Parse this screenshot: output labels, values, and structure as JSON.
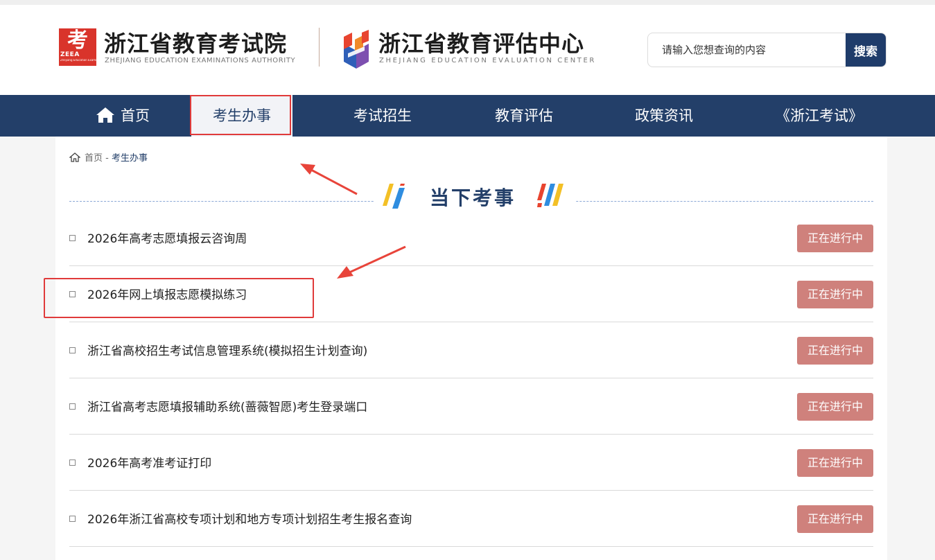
{
  "header": {
    "logo1": {
      "mark_glyph": "考",
      "mark_abbr": "ZEEA",
      "mark_tiny": "Zhejiang Education Examinations Authority",
      "title": "浙江省教育考试院",
      "subtitle": "ZHEJIANG EDUCATION EXAMINATIONS AUTHORITY"
    },
    "logo2": {
      "title": "浙江省教育评估中心",
      "subtitle": "ZHEJIANG EDUCATION EVALUATION CENTER"
    },
    "search": {
      "placeholder": "请输入您想查询的内容",
      "button_label": "搜索"
    }
  },
  "nav": {
    "items": [
      {
        "label": "首页",
        "icon": "home-icon"
      },
      {
        "label": "考生办事",
        "active": true
      },
      {
        "label": "考试招生"
      },
      {
        "label": "教育评估"
      },
      {
        "label": "政策资讯"
      },
      {
        "label": "《浙江考试》"
      }
    ]
  },
  "breadcrumb": {
    "home": "首页",
    "separator": "-",
    "current": "考生办事"
  },
  "section": {
    "title": "当下考事"
  },
  "items": [
    {
      "title": "2026年高考志愿填报云咨询周",
      "status": "正在进行中"
    },
    {
      "title": "2026年网上填报志愿模拟练习",
      "status": "正在进行中"
    },
    {
      "title": "浙江省高校招生考试信息管理系统(模拟招生计划查询)",
      "status": "正在进行中"
    },
    {
      "title": "浙江省高考志愿填报辅助系统(蔷薇智愿)考生登录端口",
      "status": "正在进行中"
    },
    {
      "title": "2026年高考准考证打印",
      "status": "正在进行中"
    },
    {
      "title": "2026年浙江省高校专项计划和地方专项计划招生考生报名查询",
      "status": "正在进行中"
    }
  ],
  "colors": {
    "nav_bg": "#233f69",
    "badge_bg": "#cf817c",
    "annotation_red": "#e03a3a",
    "search_btn": "#1f3c6a"
  }
}
